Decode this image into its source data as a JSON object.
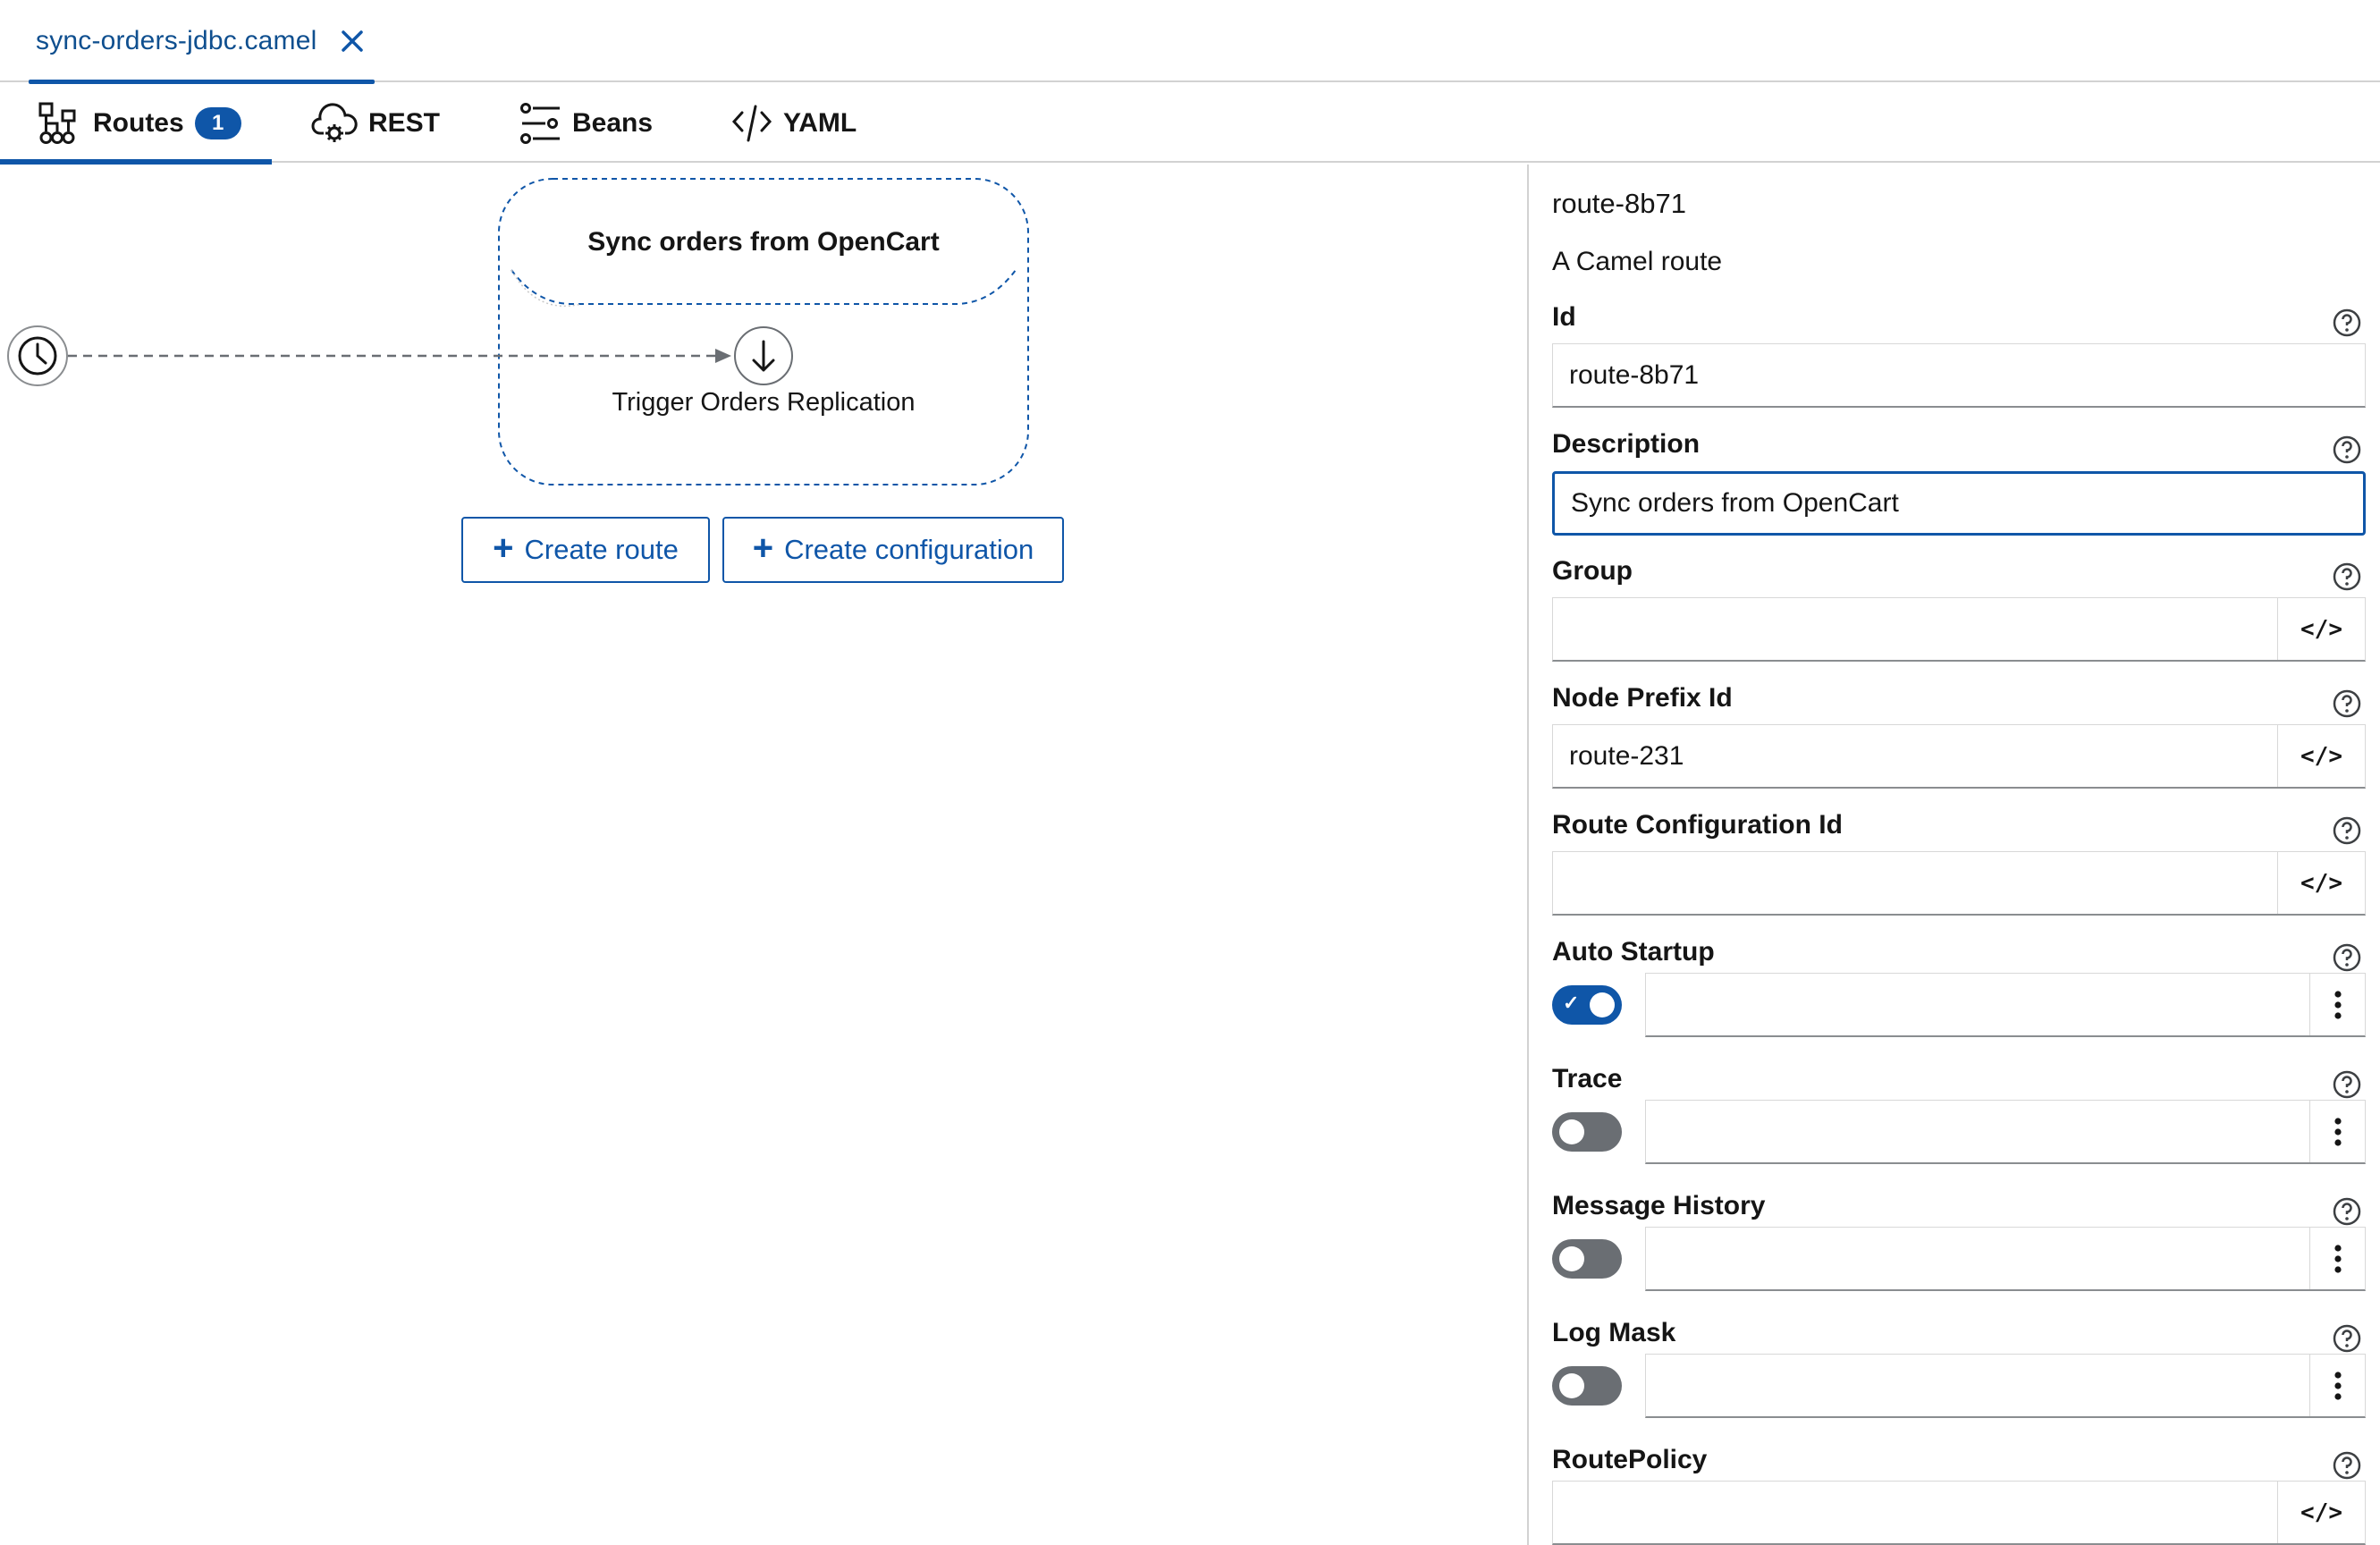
{
  "file_tab": {
    "name": "sync-orders-jdbc.camel"
  },
  "view_tabs": [
    {
      "label": "Routes",
      "badge": "1",
      "icon": "topology-icon"
    },
    {
      "label": "REST",
      "icon": "cloud-gear-icon"
    },
    {
      "label": "Beans",
      "icon": "sliders-icon"
    },
    {
      "label": "YAML",
      "icon": "code-icon"
    }
  ],
  "canvas": {
    "route_title": "Sync orders from OpenCart",
    "step_label": "Trigger Orders Replication",
    "create_route": "Create route",
    "create_configuration": "Create configuration"
  },
  "panel": {
    "title": "route-8b71",
    "description": "A Camel route",
    "fields": {
      "id": {
        "label": "Id",
        "value": "route-8b71"
      },
      "description": {
        "label": "Description",
        "value": "Sync orders from OpenCart"
      },
      "group": {
        "label": "Group",
        "value": ""
      },
      "node_prefix_id": {
        "label": "Node Prefix Id",
        "value": "route-231"
      },
      "route_configuration_id": {
        "label": "Route Configuration Id",
        "value": ""
      },
      "auto_startup": {
        "label": "Auto Startup",
        "enabled": true
      },
      "trace": {
        "label": "Trace",
        "enabled": false
      },
      "message_history": {
        "label": "Message History",
        "enabled": false
      },
      "log_mask": {
        "label": "Log Mask",
        "enabled": false
      },
      "route_policy": {
        "label": "RoutePolicy",
        "value": ""
      }
    },
    "code_button": "</>"
  },
  "colors": {
    "accent": "#0f56a8",
    "toggle_off": "#6a6e73",
    "text": "#151515"
  }
}
